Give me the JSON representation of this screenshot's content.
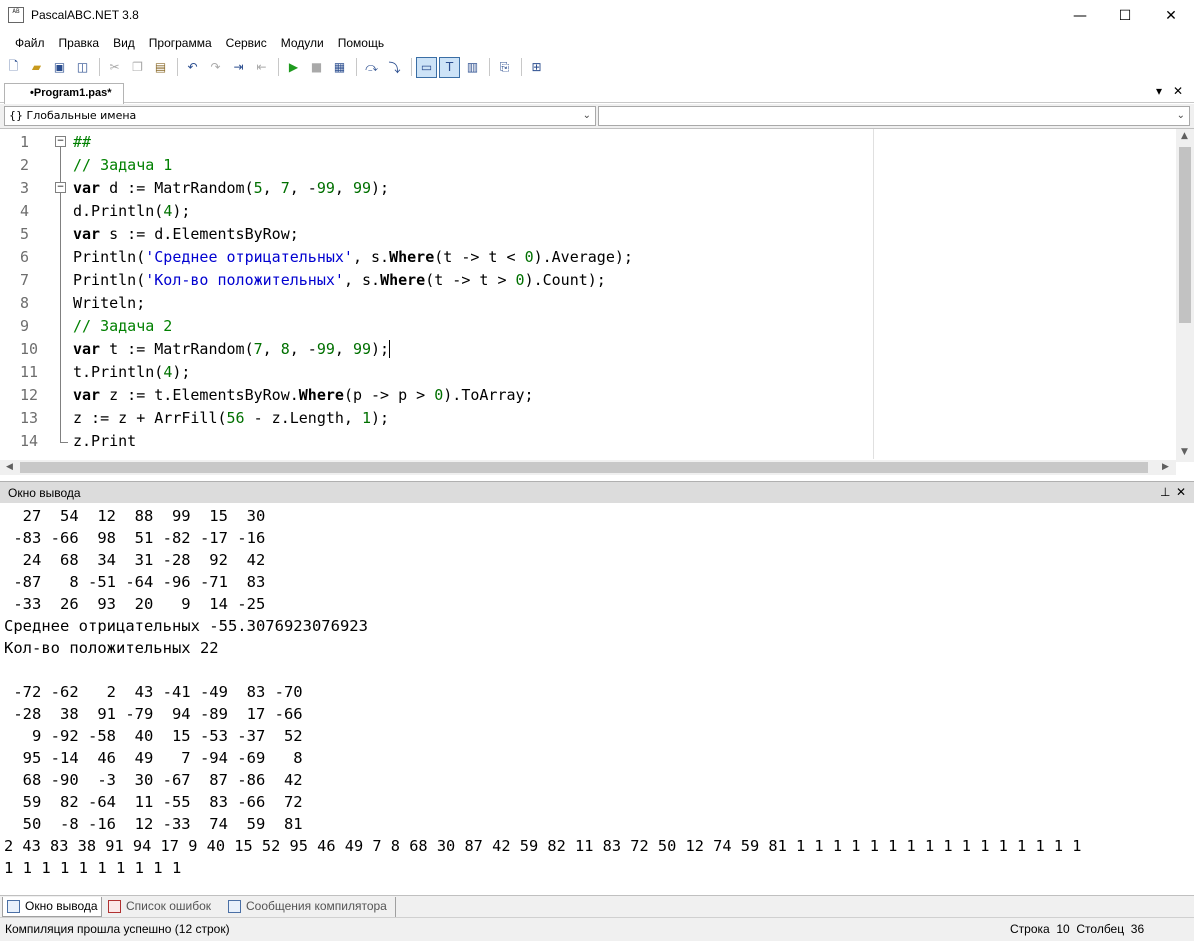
{
  "window": {
    "title": "PascalABC.NET 3.8",
    "icon_text": "AB",
    "minimize": "—",
    "maximize": "☐",
    "close": "✕"
  },
  "menu": [
    "Файл",
    "Правка",
    "Вид",
    "Программа",
    "Сервис",
    "Модули",
    "Помощь"
  ],
  "toolbar": {
    "icons": [
      "new-file-icon",
      "open-folder-icon",
      "save-icon",
      "save-all-icon",
      "cut-icon",
      "copy-icon",
      "paste-icon",
      "undo-icon",
      "redo-icon",
      "indent-icon",
      "outdent-icon",
      "run-icon",
      "stop-icon",
      "compile-icon",
      "step-over-icon",
      "step-into-icon",
      "console-icon",
      "text-icon",
      "grid-icon",
      "format-icon",
      "debug-icon"
    ]
  },
  "editor_tab": {
    "label": "•Program1.pas*",
    "dropdown": "▾",
    "close": "✕"
  },
  "combos": {
    "left": "{} Глобальные имена",
    "right": ""
  },
  "code": {
    "line_numbers": [
      "1",
      "2",
      "3",
      "4",
      "5",
      "6",
      "7",
      "8",
      "9",
      "10",
      "11",
      "12",
      "13",
      "14"
    ],
    "fold_open": "−"
  },
  "output": {
    "title": "Окно вывода",
    "pin": "⊥",
    "close": "✕",
    "lines": [
      "  27  54  12  88  99  15  30",
      " -83 -66  98  51 -82 -17 -16",
      "  24  68  34  31 -28  92  42",
      " -87   8 -51 -64 -96 -71  83",
      " -33  26  93  20   9  14 -25",
      "Среднее отрицательных -55.3076923076923",
      "Кол-во положительных 22",
      "",
      " -72 -62   2  43 -41 -49  83 -70",
      " -28  38  91 -79  94 -89  17 -66",
      "   9 -92 -58  40  15 -53 -37  52",
      "  95 -14  46  49   7 -94 -69   8",
      "  68 -90  -3  30 -67  87 -86  42",
      "  59  82 -64  11 -55  83 -66  72",
      "  50  -8 -16  12 -33  74  59  81",
      "2 43 83 38 91 94 17 9 40 15 52 95 46 49 7 8 68 30 87 42 59 82 11 83 72 50 12 74 59 81 1 1 1 1 1 1 1 1 1 1 1 1 1 1 1 1",
      "1 1 1 1 1 1 1 1 1 1"
    ]
  },
  "bottom_tabs": [
    "Окно вывода",
    "Список ошибок",
    "Сообщения компилятора"
  ],
  "status": {
    "message": "Компиляция прошла успешно (12 строк)",
    "position": "Строка  10  Столбец  36"
  }
}
